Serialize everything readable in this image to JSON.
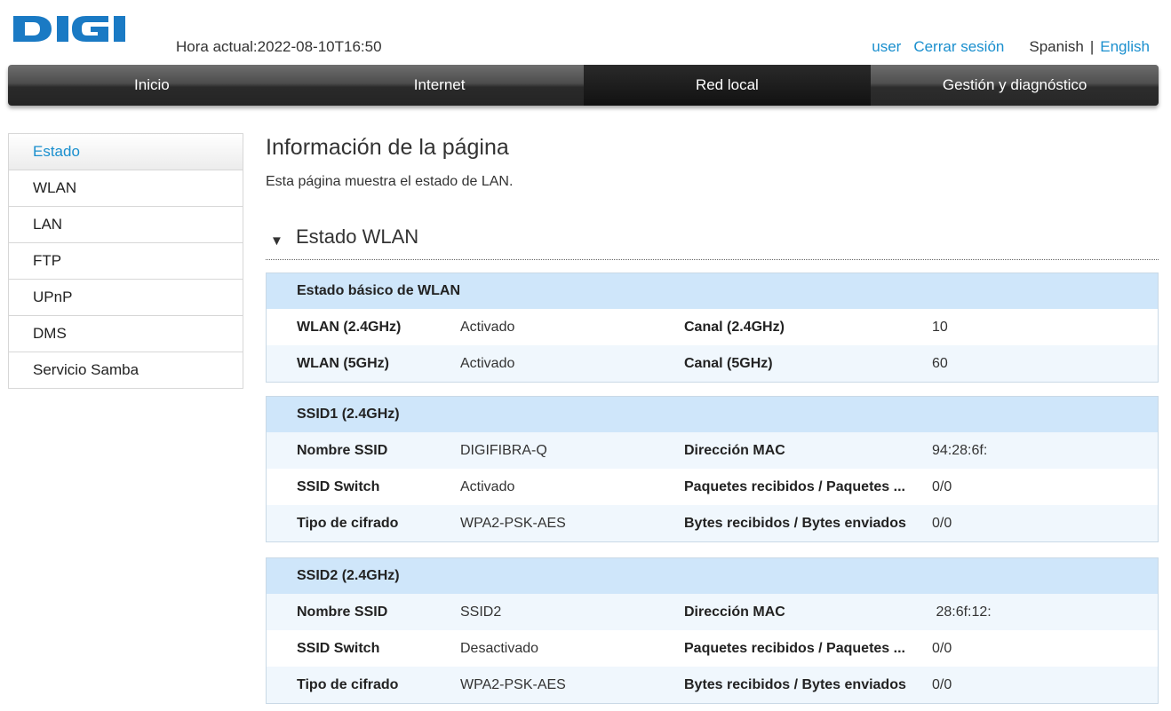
{
  "brand": {
    "name": "DIGI",
    "color": "#1a7ac4"
  },
  "header": {
    "clock_label": "Hora actual:2022-08-10T16:50",
    "user_link": "user",
    "logout_link": "Cerrar sesión",
    "lang_current": "Spanish",
    "lang_separator": "|",
    "lang_other": "English"
  },
  "nav": {
    "tabs": [
      {
        "label": "Inicio"
      },
      {
        "label": "Internet"
      },
      {
        "label": "Red local",
        "active": true
      },
      {
        "label": "Gestión y diagnóstico"
      }
    ]
  },
  "sidebar": {
    "items": [
      {
        "label": "Estado",
        "active": true
      },
      {
        "label": "WLAN"
      },
      {
        "label": "LAN"
      },
      {
        "label": "FTP"
      },
      {
        "label": "UPnP"
      },
      {
        "label": "DMS"
      },
      {
        "label": "Servicio Samba"
      }
    ]
  },
  "main": {
    "title": "Información de la página",
    "description": "Esta página muestra el estado de LAN.",
    "section_title": "Estado WLAN",
    "section_icon": "triangle-down-icon",
    "boxes": [
      {
        "header": "Estado básico de WLAN",
        "rows": [
          [
            "WLAN (2.4GHz)",
            "Activado",
            "Canal (2.4GHz)",
            "10"
          ],
          [
            "WLAN (5GHz)",
            "Activado",
            "Canal (5GHz)",
            "60"
          ]
        ]
      },
      {
        "header": "SSID1 (2.4GHz)",
        "rows": [
          [
            "Nombre SSID",
            "DIGIFIBRA-Q",
            "Dirección MAC",
            "94:28:6f:"
          ],
          [
            "SSID Switch",
            "Activado",
            "Paquetes recibidos / Paquetes ...",
            "0/0"
          ],
          [
            "Tipo de cifrado",
            "WPA2-PSK-AES",
            "Bytes recibidos / Bytes enviados",
            "0/0"
          ]
        ]
      },
      {
        "header": "SSID2 (2.4GHz)",
        "rows": [
          [
            "Nombre SSID",
            "SSID2",
            "Dirección MAC",
            " 28:6f:12:"
          ],
          [
            "SSID Switch",
            "Desactivado",
            "Paquetes recibidos / Paquetes ...",
            "0/0"
          ],
          [
            "Tipo de cifrado",
            "WPA2-PSK-AES",
            "Bytes recibidos / Bytes enviados",
            "0/0"
          ]
        ]
      }
    ]
  }
}
